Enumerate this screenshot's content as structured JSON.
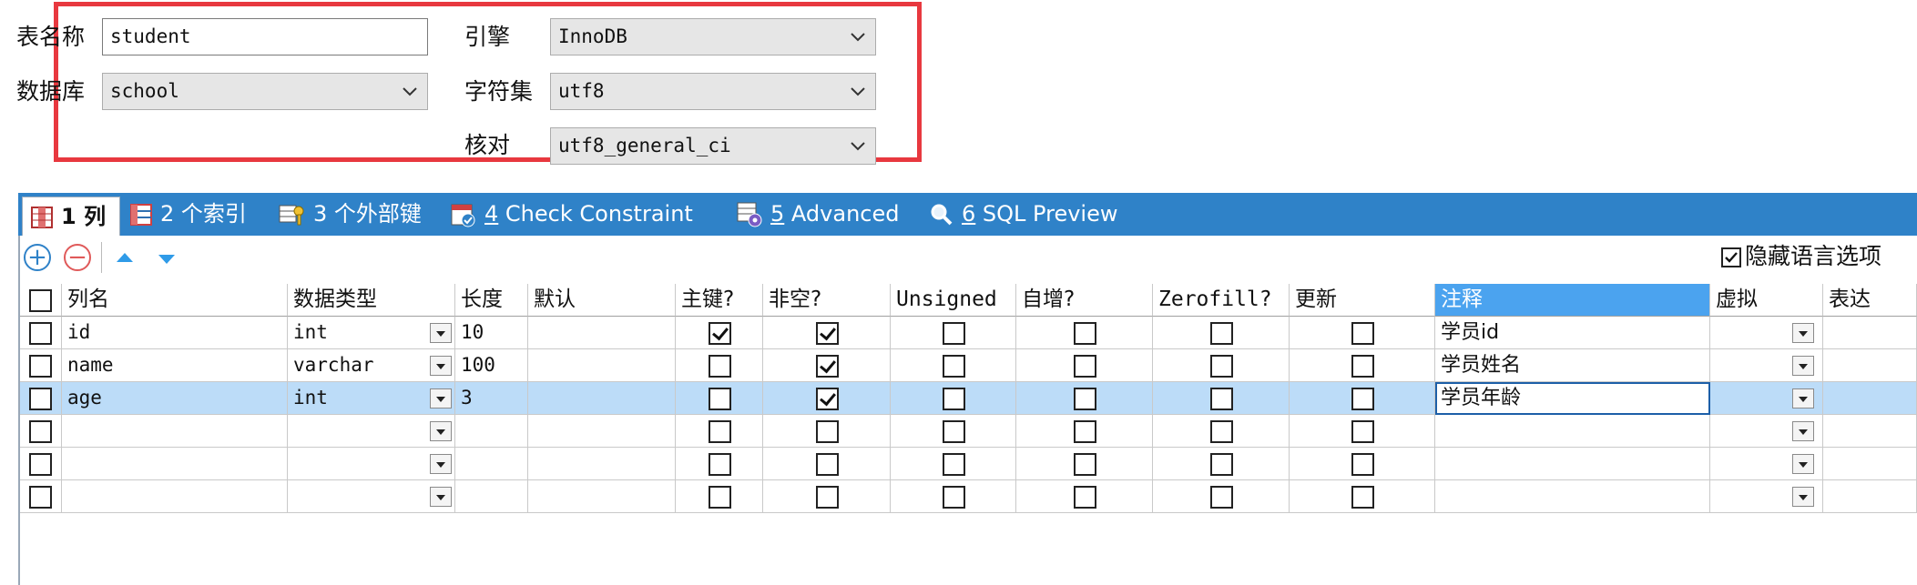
{
  "form": {
    "table_name_label": "表名称",
    "table_name_value": "student",
    "database_label": "数据库",
    "database_value": "school",
    "engine_label": "引擎",
    "engine_value": "InnoDB",
    "charset_label": "字符集",
    "charset_value": "utf8",
    "collation_label": "核对",
    "collation_value": "utf8_general_ci"
  },
  "tabs": [
    {
      "num": "1",
      "label": "列"
    },
    {
      "num": "2",
      "label": "个索引"
    },
    {
      "num": "3",
      "label": "个外部键"
    },
    {
      "num": "4",
      "label": "Check Constraint"
    },
    {
      "num": "5",
      "label": "Advanced"
    },
    {
      "num": "6",
      "label": "SQL Preview"
    }
  ],
  "toolbar": {
    "add_symbol": "+",
    "remove_symbol": "−",
    "hide_language_label": "隐藏语言选项",
    "hide_language_checked": true
  },
  "columns_header": [
    "列名",
    "数据类型",
    "长度",
    "默认",
    "主键?",
    "非空?",
    "Unsigned",
    "自增?",
    "Zerofill?",
    "更新",
    "注释",
    "虚拟",
    "表达"
  ],
  "rows": [
    {
      "name": "id",
      "type": "int",
      "length": "10",
      "default": "",
      "pk": true,
      "notnull": true,
      "unsigned": false,
      "autoinc": false,
      "zerofill": false,
      "update": false,
      "comment": "学员id",
      "selected": false
    },
    {
      "name": "name",
      "type": "varchar",
      "length": "100",
      "default": "",
      "pk": false,
      "notnull": true,
      "unsigned": false,
      "autoinc": false,
      "zerofill": false,
      "update": false,
      "comment": "学员姓名",
      "selected": false
    },
    {
      "name": "age",
      "type": "int",
      "length": "3",
      "default": "",
      "pk": false,
      "notnull": true,
      "unsigned": false,
      "autoinc": false,
      "zerofill": false,
      "update": false,
      "comment": "学员年龄",
      "selected": true
    },
    {
      "name": "",
      "type": "",
      "length": "",
      "default": "",
      "pk": false,
      "notnull": false,
      "unsigned": false,
      "autoinc": false,
      "zerofill": false,
      "update": false,
      "comment": "",
      "selected": false
    },
    {
      "name": "",
      "type": "",
      "length": "",
      "default": "",
      "pk": false,
      "notnull": false,
      "unsigned": false,
      "autoinc": false,
      "zerofill": false,
      "update": false,
      "comment": "",
      "selected": false
    },
    {
      "name": "",
      "type": "",
      "length": "",
      "default": "",
      "pk": false,
      "notnull": false,
      "unsigned": false,
      "autoinc": false,
      "zerofill": false,
      "update": false,
      "comment": "",
      "selected": false
    }
  ],
  "colors": {
    "highlight_border": "#e8383f",
    "tabbar": "#2f82c8",
    "selected_header": "#4ba3ef",
    "selected_row": "#bcdcf8"
  }
}
